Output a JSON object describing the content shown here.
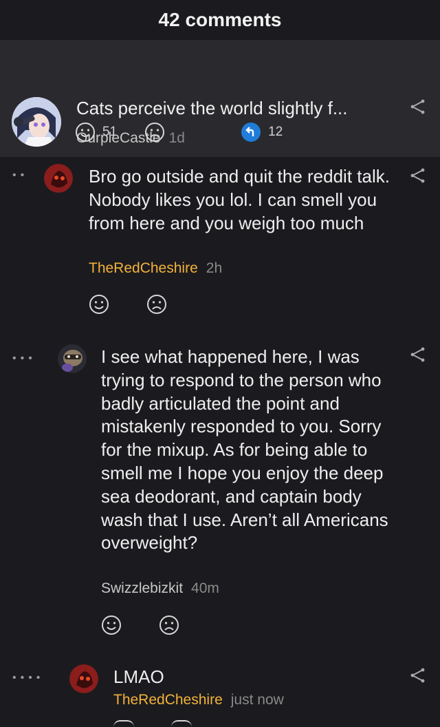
{
  "header": {
    "title": "42 comments"
  },
  "op": {
    "title": "Cats perceive the world slightly f...",
    "author": "OurpleCastle",
    "time": "1d",
    "upvotes": "51",
    "replies": "12"
  },
  "comments": [
    {
      "depth_dots": "••",
      "text": "Bro go outside and quit the reddit talk. Nobody likes you lol. I can smell you from here and you weigh too much",
      "author": "TheRedCheshire",
      "time": "2h"
    },
    {
      "depth_dots": "•••",
      "text": "I see what happened here, I was trying to respond to the person who badly articulated the point and mistakenly responded to you. Sorry for the mixup. As for being able to smell me I hope you enjoy the deep sea deodorant, and captain body wash that I use. Aren’t all Americans overweight?",
      "author": "Swizzlebizkit",
      "time": "40m"
    },
    {
      "depth_dots": "••••",
      "text": "LMAO",
      "author": "TheRedCheshire",
      "time": "just now"
    }
  ],
  "colors": {
    "author_highlight": "#f3b23a",
    "reply_badge": "#1f7dd9",
    "op_background": "#2a2a2e"
  }
}
